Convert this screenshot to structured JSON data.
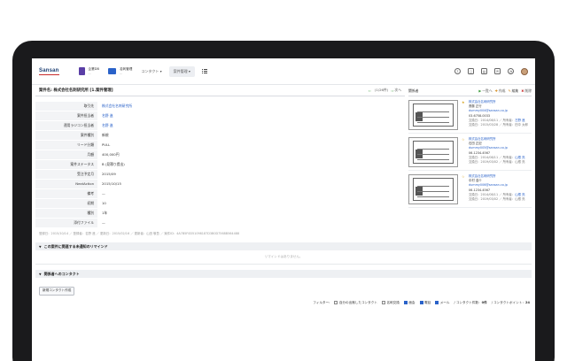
{
  "header": {
    "logo": "Sansan",
    "apps": [
      {
        "label": "企業DB",
        "sub": "---"
      },
      {
        "label": "名刺管理",
        "sub": "---"
      }
    ],
    "menus": [
      "コンタクト ▾",
      "案件管理 ▾"
    ]
  },
  "deal": {
    "title_prefix": "案件名:",
    "title": "株式会社名刺研究所 [1.案件管理]",
    "nav": {
      "counter": "(1/26件)",
      "next": "次へ",
      "list": "一覧へ",
      "create": "作成",
      "edit": "編集",
      "delete": "削除"
    }
  },
  "fields": [
    {
      "label": "取引先",
      "value": "株式会社名刺研究所",
      "link": true
    },
    {
      "label": "案件担当者",
      "value": "名野 進",
      "link": true
    },
    {
      "label": "運用ラジコン担当者",
      "value": "名野 進",
      "link": true
    },
    {
      "label": "案件種別",
      "value": "新規",
      "link": false
    },
    {
      "label": "リード分類",
      "value": "PULL",
      "link": false
    },
    {
      "label": "月額",
      "value": "400,000円",
      "link": false
    },
    {
      "label": "案件ステータス",
      "value": "B (見積り提出)",
      "link": false
    },
    {
      "label": "受注予定月",
      "value": "2015/09",
      "link": false
    },
    {
      "label": "NextAction",
      "value": "2015/10/15",
      "link": false
    },
    {
      "label": "備考",
      "value": "—",
      "link": false
    },
    {
      "label": "初期",
      "value": "10",
      "link": false
    },
    {
      "label": "種別",
      "value": "1年",
      "link": false
    },
    {
      "label": "添付ファイル",
      "value": "—",
      "link": false
    }
  ],
  "meta": "登録日：2015/10/14 ／ 登録者：名野 進 ／ 更新日：2015/02/16 ／ 更新者：山田 敬吾 ／ 案件ID：4A7B5F0D51098187D3B0D7568B564488",
  "sections": {
    "reminder": "この案件に関連する未通知のリマインド",
    "reminder_empty": "リマインドはありません。",
    "contact": "関係者へのコンタクト",
    "contact_button": "新規コンタクト作成"
  },
  "filter": {
    "label": "フィルター:",
    "items": [
      {
        "label": "自分の出席したコンタクト",
        "on": false
      },
      {
        "label": "名刺交換",
        "on": false
      },
      {
        "label": "面会",
        "on": true
      },
      {
        "label": "電話",
        "on": true
      },
      {
        "label": "メール",
        "on": true
      }
    ],
    "count_label": "コンタクト件数：",
    "count": "0件",
    "points_label": "コンタクトポイント：",
    "points": "24"
  },
  "related": {
    "title": "関係者",
    "cards": [
      {
        "company": "株式会社名刺研究所",
        "name": "斎藤 正行",
        "email": "dummy004@sansan.co.jp",
        "phone": "03-6758-0033",
        "date": "交換日：2014/08/11 ／ 所有者：",
        "owner": "古野 進",
        "last": "交換日：2015/03/28 ／ 所有者：田中 太郎"
      },
      {
        "company": "株式会社名刺研究所",
        "name": "石田 正記",
        "email": "dummy005@sansan.co.jp",
        "phone": "06-1234-4567",
        "date": "交換日：2014/08/11 ／ 所有者：",
        "owner": "山根 亮",
        "last": "交換日：2019/03/02 ／ 所有者：山根 亮"
      },
      {
        "company": "株式会社名刺研究所",
        "name": "中村 浩介",
        "email": "dummy006@sansan.co.jp",
        "phone": "06-1234-4567",
        "date": "交換日：2014/08/11 ／ 所有者：",
        "owner": "山根 亮",
        "last": "交換日：2019/03/02 ／ 所有者：山根 亮"
      }
    ]
  }
}
